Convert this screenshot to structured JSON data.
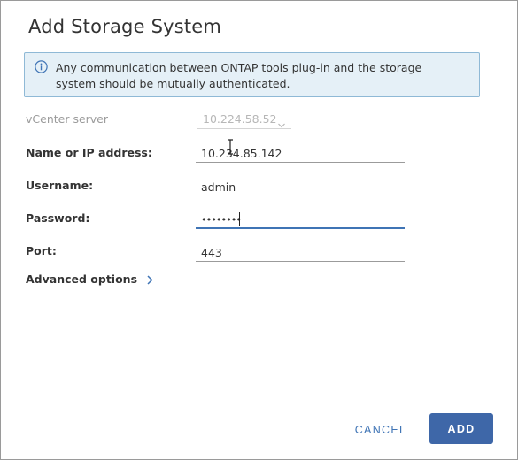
{
  "dialog": {
    "title": "Add Storage System"
  },
  "info_banner": {
    "text": "Any communication between ONTAP tools plug-in and the storage system should be mutually authenticated.",
    "icon": "info-icon"
  },
  "form": {
    "vcenter": {
      "label": "vCenter server",
      "value": "10.224.58.52",
      "disabled": true
    },
    "name_ip": {
      "label": "Name or IP address:",
      "value": "10.234.85.142"
    },
    "username": {
      "label": "Username:",
      "value": "admin"
    },
    "password": {
      "label": "Password:",
      "value": "••••••••",
      "focused": true
    },
    "port": {
      "label": "Port:",
      "value": "443"
    },
    "advanced": {
      "label": "Advanced options",
      "icon": "chevron-right-icon"
    }
  },
  "buttons": {
    "cancel_label": "CANCEL",
    "add_label": "ADD"
  },
  "colors": {
    "accent": "#3e67a8",
    "link": "#3f74b5",
    "info_bg": "#e5f0f7",
    "info_border": "#8fb9d6"
  }
}
